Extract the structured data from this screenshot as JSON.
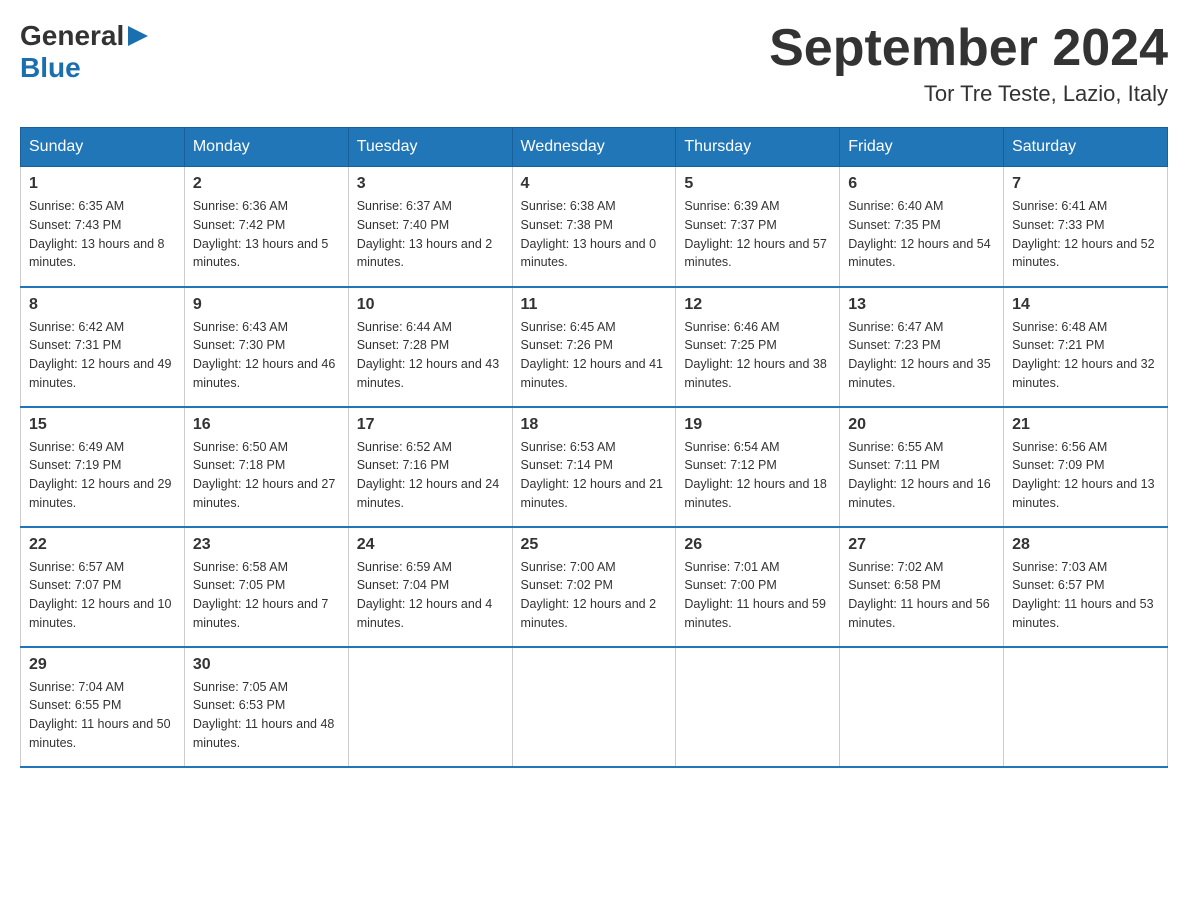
{
  "header": {
    "logo_general": "General",
    "logo_blue": "Blue",
    "title": "September 2024",
    "subtitle": "Tor Tre Teste, Lazio, Italy"
  },
  "columns": [
    "Sunday",
    "Monday",
    "Tuesday",
    "Wednesday",
    "Thursday",
    "Friday",
    "Saturday"
  ],
  "weeks": [
    [
      {
        "day": "1",
        "sunrise": "6:35 AM",
        "sunset": "7:43 PM",
        "daylight": "13 hours and 8 minutes."
      },
      {
        "day": "2",
        "sunrise": "6:36 AM",
        "sunset": "7:42 PM",
        "daylight": "13 hours and 5 minutes."
      },
      {
        "day": "3",
        "sunrise": "6:37 AM",
        "sunset": "7:40 PM",
        "daylight": "13 hours and 2 minutes."
      },
      {
        "day": "4",
        "sunrise": "6:38 AM",
        "sunset": "7:38 PM",
        "daylight": "13 hours and 0 minutes."
      },
      {
        "day": "5",
        "sunrise": "6:39 AM",
        "sunset": "7:37 PM",
        "daylight": "12 hours and 57 minutes."
      },
      {
        "day": "6",
        "sunrise": "6:40 AM",
        "sunset": "7:35 PM",
        "daylight": "12 hours and 54 minutes."
      },
      {
        "day": "7",
        "sunrise": "6:41 AM",
        "sunset": "7:33 PM",
        "daylight": "12 hours and 52 minutes."
      }
    ],
    [
      {
        "day": "8",
        "sunrise": "6:42 AM",
        "sunset": "7:31 PM",
        "daylight": "12 hours and 49 minutes."
      },
      {
        "day": "9",
        "sunrise": "6:43 AM",
        "sunset": "7:30 PM",
        "daylight": "12 hours and 46 minutes."
      },
      {
        "day": "10",
        "sunrise": "6:44 AM",
        "sunset": "7:28 PM",
        "daylight": "12 hours and 43 minutes."
      },
      {
        "day": "11",
        "sunrise": "6:45 AM",
        "sunset": "7:26 PM",
        "daylight": "12 hours and 41 minutes."
      },
      {
        "day": "12",
        "sunrise": "6:46 AM",
        "sunset": "7:25 PM",
        "daylight": "12 hours and 38 minutes."
      },
      {
        "day": "13",
        "sunrise": "6:47 AM",
        "sunset": "7:23 PM",
        "daylight": "12 hours and 35 minutes."
      },
      {
        "day": "14",
        "sunrise": "6:48 AM",
        "sunset": "7:21 PM",
        "daylight": "12 hours and 32 minutes."
      }
    ],
    [
      {
        "day": "15",
        "sunrise": "6:49 AM",
        "sunset": "7:19 PM",
        "daylight": "12 hours and 29 minutes."
      },
      {
        "day": "16",
        "sunrise": "6:50 AM",
        "sunset": "7:18 PM",
        "daylight": "12 hours and 27 minutes."
      },
      {
        "day": "17",
        "sunrise": "6:52 AM",
        "sunset": "7:16 PM",
        "daylight": "12 hours and 24 minutes."
      },
      {
        "day": "18",
        "sunrise": "6:53 AM",
        "sunset": "7:14 PM",
        "daylight": "12 hours and 21 minutes."
      },
      {
        "day": "19",
        "sunrise": "6:54 AM",
        "sunset": "7:12 PM",
        "daylight": "12 hours and 18 minutes."
      },
      {
        "day": "20",
        "sunrise": "6:55 AM",
        "sunset": "7:11 PM",
        "daylight": "12 hours and 16 minutes."
      },
      {
        "day": "21",
        "sunrise": "6:56 AM",
        "sunset": "7:09 PM",
        "daylight": "12 hours and 13 minutes."
      }
    ],
    [
      {
        "day": "22",
        "sunrise": "6:57 AM",
        "sunset": "7:07 PM",
        "daylight": "12 hours and 10 minutes."
      },
      {
        "day": "23",
        "sunrise": "6:58 AM",
        "sunset": "7:05 PM",
        "daylight": "12 hours and 7 minutes."
      },
      {
        "day": "24",
        "sunrise": "6:59 AM",
        "sunset": "7:04 PM",
        "daylight": "12 hours and 4 minutes."
      },
      {
        "day": "25",
        "sunrise": "7:00 AM",
        "sunset": "7:02 PM",
        "daylight": "12 hours and 2 minutes."
      },
      {
        "day": "26",
        "sunrise": "7:01 AM",
        "sunset": "7:00 PM",
        "daylight": "11 hours and 59 minutes."
      },
      {
        "day": "27",
        "sunrise": "7:02 AM",
        "sunset": "6:58 PM",
        "daylight": "11 hours and 56 minutes."
      },
      {
        "day": "28",
        "sunrise": "7:03 AM",
        "sunset": "6:57 PM",
        "daylight": "11 hours and 53 minutes."
      }
    ],
    [
      {
        "day": "29",
        "sunrise": "7:04 AM",
        "sunset": "6:55 PM",
        "daylight": "11 hours and 50 minutes."
      },
      {
        "day": "30",
        "sunrise": "7:05 AM",
        "sunset": "6:53 PM",
        "daylight": "11 hours and 48 minutes."
      },
      null,
      null,
      null,
      null,
      null
    ]
  ],
  "labels": {
    "sunrise": "Sunrise:",
    "sunset": "Sunset:",
    "daylight": "Daylight:"
  }
}
